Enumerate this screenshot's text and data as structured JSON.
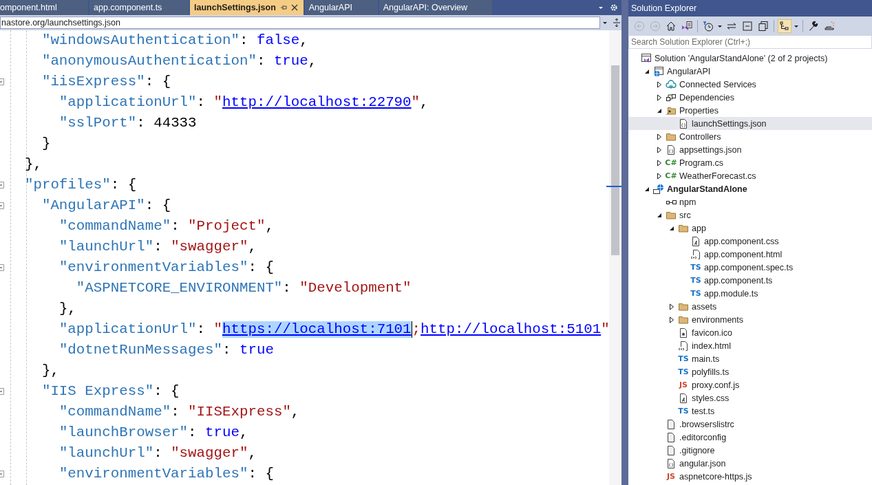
{
  "tabs": [
    {
      "label": "omponent.html",
      "selected": false
    },
    {
      "label": "app.component.ts",
      "selected": false
    },
    {
      "label": "launchSettings.json",
      "selected": true
    },
    {
      "label": "AngularAPI",
      "selected": false
    },
    {
      "label": "AngularAPI: Overview",
      "selected": false
    }
  ],
  "address_bar": {
    "value": "nastore.org/launchsettings.json"
  },
  "code_lines": [
    {
      "children": [
        {
          "tokens": [
            {
              "kind": "key",
              "text": "\"windowsAuthentication\""
            },
            {
              "kind": "punct",
              "text": ": "
            },
            {
              "kind": "keyword",
              "text": "false"
            },
            {
              "kind": "punct",
              "text": ","
            }
          ]
        },
        {
          "tokens": [
            {
              "kind": "key",
              "text": "\"anonymousAuthentication\""
            },
            {
              "kind": "punct",
              "text": ": "
            },
            {
              "kind": "keyword",
              "text": "true"
            },
            {
              "kind": "punct",
              "text": ","
            }
          ]
        },
        {
          "collapsible": true,
          "tokens": [
            {
              "kind": "key",
              "text": "\"iisExpress\""
            },
            {
              "kind": "punct",
              "text": ": {"
            }
          ],
          "children": [
            {
              "tokens": [
                {
                  "kind": "key",
                  "text": "\"applicationUrl\""
                },
                {
                  "kind": "punct",
                  "text": ": "
                },
                {
                  "kind": "string",
                  "text": "\""
                },
                {
                  "kind": "link",
                  "text": "http://localhost:22790"
                },
                {
                  "kind": "string",
                  "text": "\""
                },
                {
                  "kind": "punct",
                  "text": ","
                }
              ]
            },
            {
              "tokens": [
                {
                  "kind": "key",
                  "text": "\"sslPort\""
                },
                {
                  "kind": "punct",
                  "text": ": "
                },
                {
                  "kind": "number",
                  "text": "44333"
                }
              ]
            }
          ]
        },
        {
          "tokens": [
            {
              "kind": "punct",
              "text": "}"
            }
          ]
        }
      ]
    },
    {
      "tokens": [
        {
          "kind": "punct",
          "text": "},"
        }
      ]
    },
    {
      "collapsible": true,
      "tokens": [
        {
          "kind": "key",
          "text": "\"profiles\""
        },
        {
          "kind": "punct",
          "text": ": {"
        }
      ],
      "children": [
        {
          "collapsible": true,
          "tokens": [
            {
              "kind": "key",
              "text": "\"AngularAPI\""
            },
            {
              "kind": "punct",
              "text": ": {"
            }
          ],
          "children": [
            {
              "tokens": [
                {
                  "kind": "key",
                  "text": "\"commandName\""
                },
                {
                  "kind": "punct",
                  "text": ": "
                },
                {
                  "kind": "string",
                  "text": "\"Project\""
                },
                {
                  "kind": "punct",
                  "text": ","
                }
              ]
            },
            {
              "tokens": [
                {
                  "kind": "key",
                  "text": "\"launchUrl\""
                },
                {
                  "kind": "punct",
                  "text": ": "
                },
                {
                  "kind": "string",
                  "text": "\"swagger\""
                },
                {
                  "kind": "punct",
                  "text": ","
                }
              ]
            },
            {
              "collapsible": true,
              "tokens": [
                {
                  "kind": "key",
                  "text": "\"environmentVariables\""
                },
                {
                  "kind": "punct",
                  "text": ": {"
                }
              ],
              "children": [
                {
                  "tokens": [
                    {
                      "kind": "key",
                      "text": "\"ASPNETCORE_ENVIRONMENT\""
                    },
                    {
                      "kind": "punct",
                      "text": ": "
                    },
                    {
                      "kind": "string",
                      "text": "\"Development\""
                    }
                  ]
                }
              ]
            },
            {
              "tokens": [
                {
                  "kind": "punct",
                  "text": "},"
                }
              ]
            },
            {
              "tokens": [
                {
                  "kind": "key",
                  "text": "\"applicationUrl\""
                },
                {
                  "kind": "punct",
                  "text": ": "
                },
                {
                  "kind": "string",
                  "text": "\""
                },
                {
                  "kind": "link",
                  "text": "https://localhost:7101",
                  "selected": true
                },
                {
                  "kind": "string",
                  "text": ";"
                },
                {
                  "kind": "link",
                  "text": "http://localhost:5101"
                },
                {
                  "kind": "string",
                  "text": "\""
                }
              ]
            },
            {
              "tokens": [
                {
                  "kind": "key",
                  "text": "\"dotnetRunMessages\""
                },
                {
                  "kind": "punct",
                  "text": ": "
                },
                {
                  "kind": "keyword",
                  "text": "true"
                }
              ]
            }
          ]
        },
        {
          "tokens": [
            {
              "kind": "punct",
              "text": "},"
            }
          ]
        },
        {
          "collapsible": true,
          "tokens": [
            {
              "kind": "key",
              "text": "\"IIS Express\""
            },
            {
              "kind": "punct",
              "text": ": {"
            }
          ],
          "children": [
            {
              "tokens": [
                {
                  "kind": "key",
                  "text": "\"commandName\""
                },
                {
                  "kind": "punct",
                  "text": ": "
                },
                {
                  "kind": "string",
                  "text": "\"IISExpress\""
                },
                {
                  "kind": "punct",
                  "text": ","
                }
              ]
            },
            {
              "tokens": [
                {
                  "kind": "key",
                  "text": "\"launchBrowser\""
                },
                {
                  "kind": "punct",
                  "text": ": "
                },
                {
                  "kind": "keyword",
                  "text": "true"
                },
                {
                  "kind": "punct",
                  "text": ","
                }
              ]
            },
            {
              "tokens": [
                {
                  "kind": "key",
                  "text": "\"launchUrl\""
                },
                {
                  "kind": "punct",
                  "text": ": "
                },
                {
                  "kind": "string",
                  "text": "\"swagger\""
                },
                {
                  "kind": "punct",
                  "text": ","
                }
              ]
            },
            {
              "collapsible": true,
              "tokens": [
                {
                  "kind": "key",
                  "text": "\"environmentVariables\""
                },
                {
                  "kind": "punct",
                  "text": ": {"
                }
              ]
            }
          ]
        }
      ]
    }
  ],
  "solution_explorer": {
    "title": "Solution Explorer",
    "toolbar": [
      {
        "kind": "back",
        "disabled": true
      },
      {
        "kind": "forward",
        "disabled": true
      },
      {
        "kind": "home"
      },
      {
        "kind": "switch-views"
      },
      {
        "kind": "separator"
      },
      {
        "kind": "history"
      },
      {
        "kind": "dropdown"
      },
      {
        "kind": "sync"
      },
      {
        "kind": "collapse"
      },
      {
        "kind": "copy"
      },
      {
        "kind": "separator"
      },
      {
        "kind": "show-all",
        "on": true
      },
      {
        "kind": "dropdown"
      },
      {
        "kind": "separator"
      },
      {
        "kind": "properties"
      },
      {
        "kind": "preview"
      }
    ],
    "search": {
      "placeholder": "Search Solution Explorer (Ctrl+;)"
    },
    "tree": [
      {
        "kind": "solution",
        "label": "Solution 'AngularStandAlone' (2 of 2 projects)",
        "selected": false,
        "children": [
          {
            "kind": "web-project",
            "label": "AngularAPI",
            "selected": false,
            "expanded": true,
            "children": [
              {
                "kind": "connected",
                "label": "Connected Services",
                "selected": false,
                "expanded": false
              },
              {
                "kind": "dependencies",
                "label": "Dependencies",
                "selected": false,
                "expanded": false
              },
              {
                "kind": "properties-folder",
                "label": "Properties",
                "selected": false,
                "expanded": true,
                "children": [
                  {
                    "kind": "json",
                    "label": "launchSettings.json",
                    "selected": true
                  }
                ]
              },
              {
                "kind": "folder",
                "label": "Controllers",
                "selected": false,
                "expanded": false
              },
              {
                "kind": "json",
                "label": "appsettings.json",
                "selected": false,
                "expanded": false
              },
              {
                "kind": "code",
                "icon_text": "C#",
                "color": "#388a34",
                "label": "Program.cs",
                "selected": false,
                "expanded": false
              },
              {
                "kind": "code",
                "icon_text": "C#",
                "color": "#388a34",
                "label": "WeatherForecast.cs",
                "selected": false,
                "expanded": false
              }
            ]
          },
          {
            "kind": "web-project-2",
            "label": "AngularStandAlone",
            "bold": true,
            "selected": false,
            "expanded": true,
            "children": [
              {
                "kind": "npm",
                "label": "npm",
                "selected": false
              },
              {
                "kind": "folder",
                "label": "src",
                "selected": false,
                "expanded": true,
                "children": [
                  {
                    "kind": "folder",
                    "label": "app",
                    "selected": false,
                    "expanded": true,
                    "children": [
                      {
                        "kind": "css",
                        "label": "app.component.css",
                        "selected": false
                      },
                      {
                        "kind": "html",
                        "label": "app.component.html",
                        "selected": false
                      },
                      {
                        "kind": "code",
                        "icon_text": "TS",
                        "color": "#1a73c8",
                        "label": "app.component.spec.ts",
                        "selected": false
                      },
                      {
                        "kind": "code",
                        "icon_text": "TS",
                        "color": "#1a73c8",
                        "label": "app.component.ts",
                        "selected": false
                      },
                      {
                        "kind": "code",
                        "icon_text": "TS",
                        "color": "#1a73c8",
                        "label": "app.module.ts",
                        "selected": false
                      }
                    ]
                  },
                  {
                    "kind": "folder",
                    "label": "assets",
                    "selected": false,
                    "expanded": false
                  },
                  {
                    "kind": "folder",
                    "label": "environments",
                    "selected": false,
                    "expanded": false
                  },
                  {
                    "kind": "ico",
                    "label": "favicon.ico",
                    "selected": false
                  },
                  {
                    "kind": "html",
                    "label": "index.html",
                    "selected": false
                  },
                  {
                    "kind": "code",
                    "icon_text": "TS",
                    "color": "#1a73c8",
                    "label": "main.ts",
                    "selected": false
                  },
                  {
                    "kind": "code",
                    "icon_text": "TS",
                    "color": "#1a73c8",
                    "label": "polyfills.ts",
                    "selected": false
                  },
                  {
                    "kind": "code",
                    "icon_text": "JS",
                    "color": "#d0452f",
                    "label": "proxy.conf.js",
                    "selected": false
                  },
                  {
                    "kind": "css",
                    "label": "styles.css",
                    "selected": false
                  },
                  {
                    "kind": "code",
                    "icon_text": "TS",
                    "color": "#1a73c8",
                    "label": "test.ts",
                    "selected": false
                  }
                ]
              },
              {
                "kind": "file",
                "label": ".browserslistrc",
                "selected": false
              },
              {
                "kind": "file",
                "label": ".editorconfig",
                "selected": false
              },
              {
                "kind": "file",
                "label": ".gitignore",
                "selected": false
              },
              {
                "kind": "json",
                "label": "angular.json",
                "selected": false
              },
              {
                "kind": "code",
                "icon_text": "JS",
                "color": "#d0452f",
                "label": "aspnetcore-https.js",
                "selected": false
              }
            ]
          }
        ]
      }
    ]
  }
}
